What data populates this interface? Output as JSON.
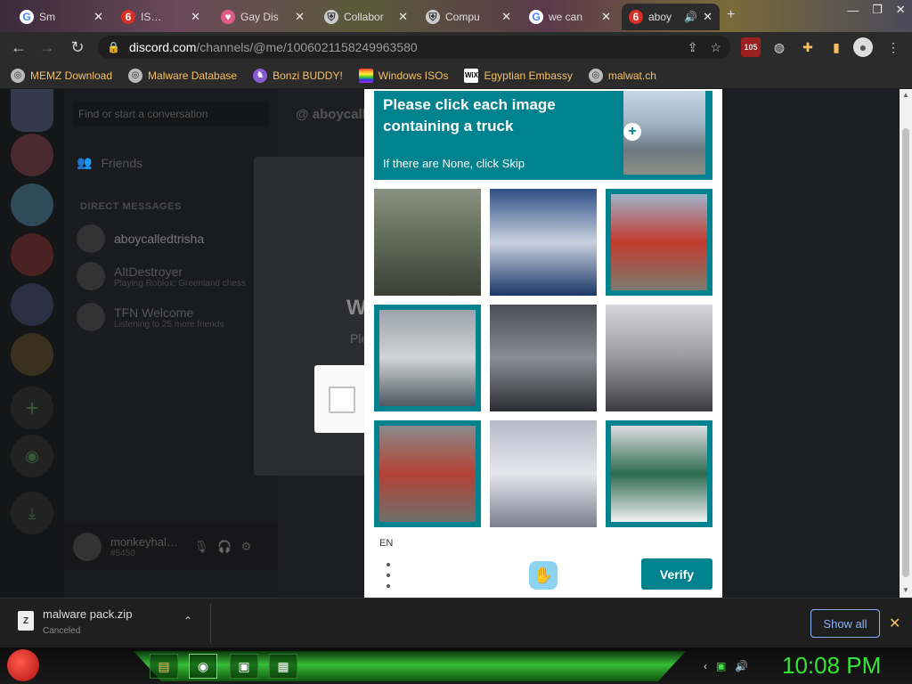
{
  "browser": {
    "tabs": [
      {
        "label": "Sm",
        "favicon": "G",
        "active": false
      },
      {
        "label": "IS…",
        "favicon": "6",
        "active": false
      },
      {
        "label": "Gay Dis",
        "favicon": "heart",
        "active": false
      },
      {
        "label": "Collabor",
        "favicon": "shield",
        "active": false
      },
      {
        "label": "Compu",
        "favicon": "shield",
        "active": false
      },
      {
        "label": "we can",
        "favicon": "G",
        "active": false
      },
      {
        "label": "aboy",
        "favicon": "6",
        "active": true
      }
    ],
    "url": {
      "host": "discord.com",
      "path": "/channels/@me/1006021158249963580"
    },
    "extension_badge": "105",
    "bookmarks": [
      {
        "label": "MEMZ Download",
        "icon": "globe-icon"
      },
      {
        "label": "Malware Database",
        "icon": "globe-icon"
      },
      {
        "label": "Bonzi BUDDY!",
        "icon": "bonzi-icon"
      },
      {
        "label": "Windows ISOs",
        "icon": "windows-icon"
      },
      {
        "label": "Egyptian Embassy",
        "icon": "wix-icon"
      },
      {
        "label": "malwat.ch",
        "icon": "globe-icon"
      }
    ]
  },
  "discord": {
    "search_placeholder": "Find or start a conversation",
    "friends_label": "Friends",
    "dm_section": "DIRECT MESSAGES",
    "dms": [
      {
        "name": "aboycalledtrisha",
        "sub": ""
      },
      {
        "name": "AltDestroyer",
        "sub": "Playing Roblox: Greenland chess"
      },
      {
        "name": "TFN Welcome",
        "sub": "Listening to 25 more friends"
      }
    ],
    "username": "monkeyhal…",
    "discriminator": "#5450",
    "header_name": "aboycalledt",
    "modal_title_partial": "W",
    "modal_text_partial": "Ple"
  },
  "captcha": {
    "prompt": "Please click each image containing a truck",
    "skip_text": "If there are None, click Skip",
    "tiles": [
      {
        "name": "truck-container",
        "selected": false,
        "colors": [
          "#8a9180",
          "#5e6a55",
          "#3c3f36"
        ]
      },
      {
        "name": "cruise-ship",
        "selected": false,
        "colors": [
          "#2e4f86",
          "#c9d2e0",
          "#1b3766"
        ]
      },
      {
        "name": "fire-truck",
        "selected": true,
        "colors": [
          "#9fb3c8",
          "#c33a2f",
          "#7b7b6e"
        ]
      },
      {
        "name": "semi-truck",
        "selected": true,
        "colors": [
          "#9aa4aa",
          "#cfd4d8",
          "#4d5a60"
        ]
      },
      {
        "name": "airplane",
        "selected": false,
        "colors": [
          "#4b4d57",
          "#8b8d96",
          "#2c2d34"
        ]
      },
      {
        "name": "motorcycle",
        "selected": false,
        "colors": [
          "#d8d6dc",
          "#9a99a2",
          "#3c3b40"
        ]
      },
      {
        "name": "fire-engine",
        "selected": true,
        "colors": [
          "#8a8a88",
          "#b44237",
          "#6e6f6a"
        ]
      },
      {
        "name": "seaplane",
        "selected": false,
        "colors": [
          "#b8bac8",
          "#e6e6ee",
          "#7b7e8e"
        ]
      },
      {
        "name": "double-decker-bus",
        "selected": true,
        "colors": [
          "#dcdde0",
          "#2d6b4f",
          "#f0f1f3"
        ]
      }
    ],
    "language": "EN",
    "verify_label": "Verify",
    "accent": "#00838f"
  },
  "download": {
    "filename": "malware pack.zip",
    "status": "Canceled",
    "show_all": "Show all"
  },
  "taskbar": {
    "clock": "10:08 PM"
  }
}
